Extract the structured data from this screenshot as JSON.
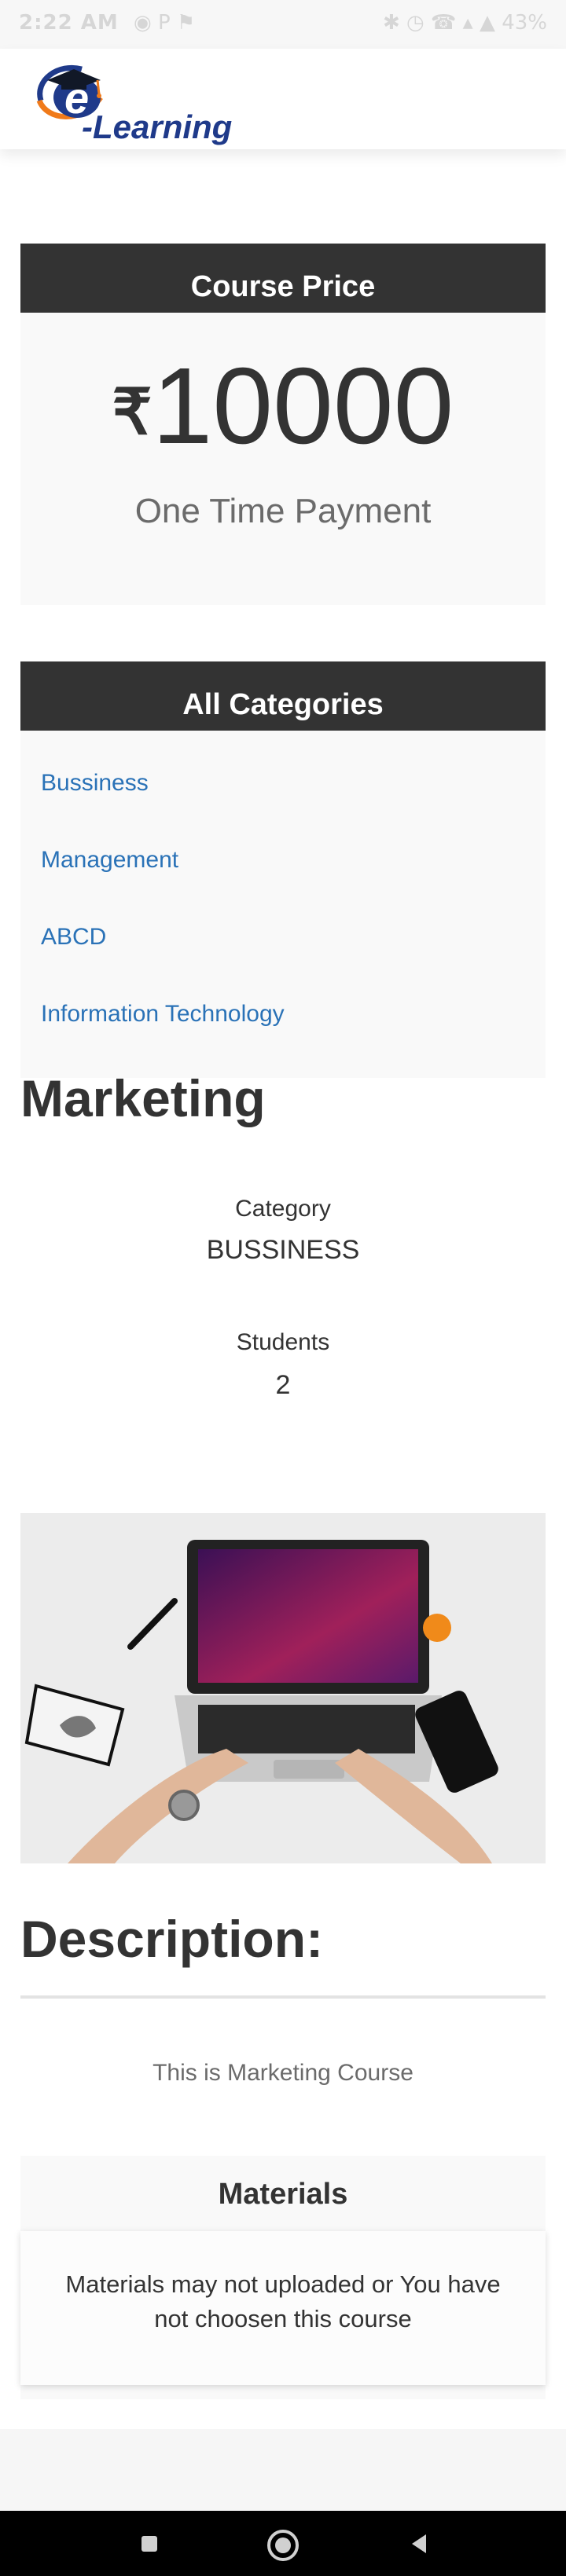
{
  "status_bar": {
    "time": "2:22 AM",
    "left_icons": "◉ P ⚑",
    "right_icons": "✱ ◷ ☎ ▴ ▲ 43%"
  },
  "header": {
    "logo_text": "-Learning",
    "logo_letter": "e",
    "brand_color": "#1f3a8a",
    "accent_color": "#f07a1a"
  },
  "price_card": {
    "title": "Course Price",
    "currency": "₹",
    "amount": "10000",
    "note": "One Time Payment"
  },
  "categories_card": {
    "title": "All Categories",
    "items": [
      "Bussiness",
      "Management",
      "ABCD",
      "Information Technology"
    ],
    "link_color": "#2a72b7"
  },
  "course": {
    "title": "Marketing",
    "category_label": "Category",
    "category_value": "BUSSINESS",
    "students_label": "Students",
    "students_value": "2"
  },
  "description": {
    "title": "Description:",
    "text": "This is Marketing Course"
  },
  "materials": {
    "title": "Materials",
    "message": "Materials may not uploaded or You have not choosen this course"
  },
  "navbar": {
    "icons": [
      "recent-apps-icon",
      "home-icon",
      "back-icon"
    ]
  }
}
